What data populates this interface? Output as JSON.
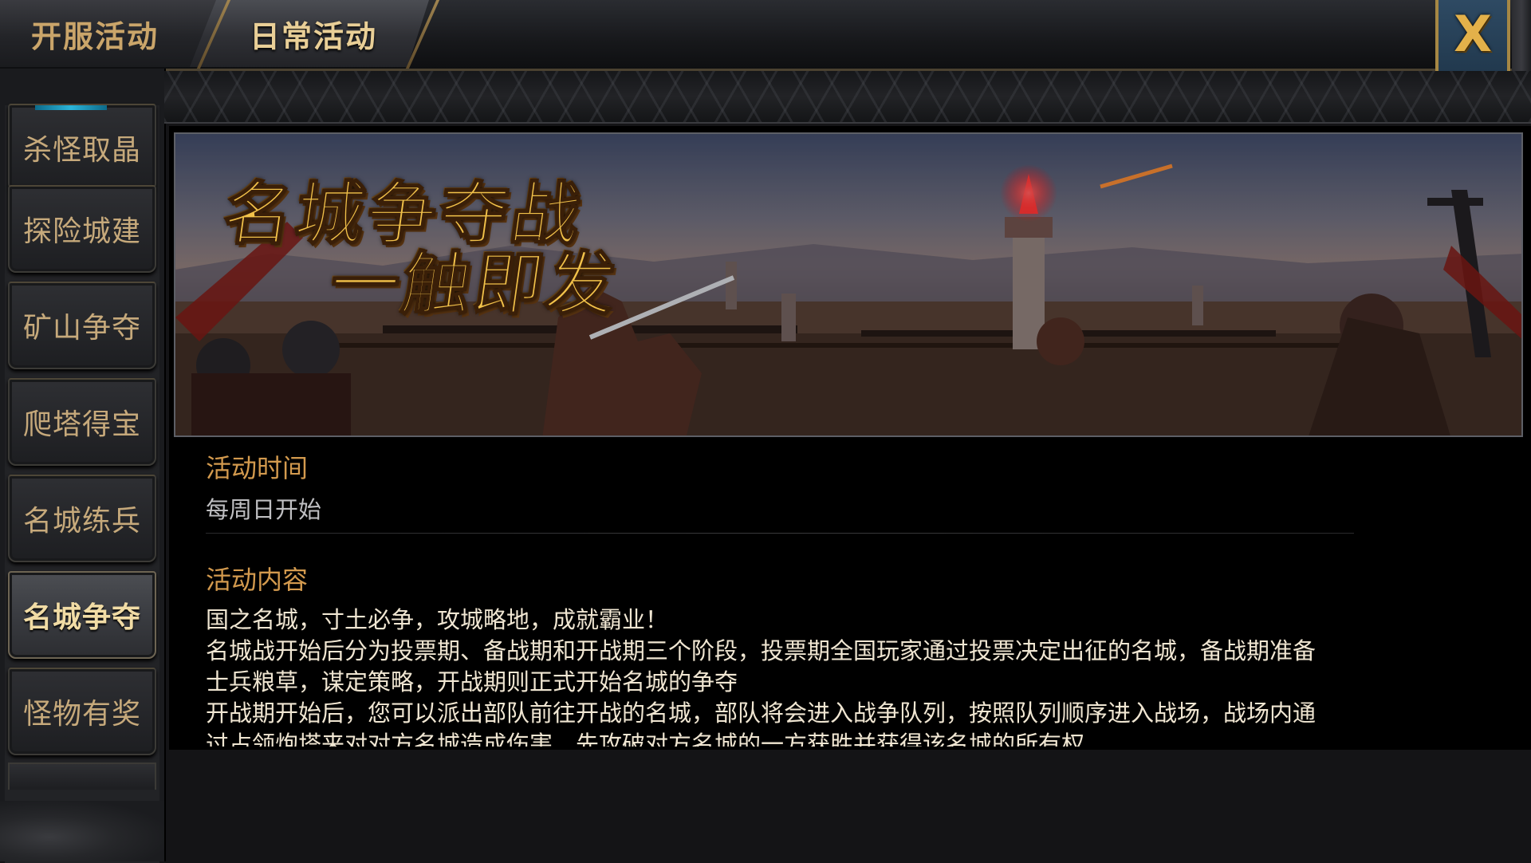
{
  "tabs": [
    {
      "label": "开服活动",
      "active": false
    },
    {
      "label": "日常活动",
      "active": true
    }
  ],
  "close_label": "X",
  "sidebar": {
    "items": [
      {
        "label": "杀怪取晶",
        "active": false
      },
      {
        "label": "探险城建",
        "active": false
      },
      {
        "label": "矿山争夺",
        "active": false
      },
      {
        "label": "爬塔得宝",
        "active": false
      },
      {
        "label": "名城练兵",
        "active": false
      },
      {
        "label": "名城争夺",
        "active": true
      },
      {
        "label": "怪物有奖",
        "active": false
      }
    ]
  },
  "banner": {
    "title_line1": "名城争夺战",
    "title_line2": "一触即发"
  },
  "activity": {
    "time_heading": "活动时间",
    "time_value": "每周日开始",
    "content_heading": "活动内容",
    "content_lines": [
      "国之名城，寸土必争，攻城略地，成就霸业！",
      "名城战开始后分为投票期、备战期和开战期三个阶段，投票期全国玩家通过投票决定出征的名城，备战期准备",
      "士兵粮草，谋定策略，开战期则正式开始名城的争夺",
      "开战期开始后，您可以派出部队前往开战的名城，部队将会进入战争队列，按照队列顺序进入战场，战场内通",
      "过占领炮塔来对对方名城造成伤害，先攻破对方名城的一方获胜并获得该名城的所有权"
    ]
  },
  "colors": {
    "tab_active_text": "#e9cf97",
    "sidebar_text": "#c6a97b",
    "section_heading": "#d39a4e",
    "body_text": "#f0e6d2",
    "close_icon": "#e3b14a"
  }
}
